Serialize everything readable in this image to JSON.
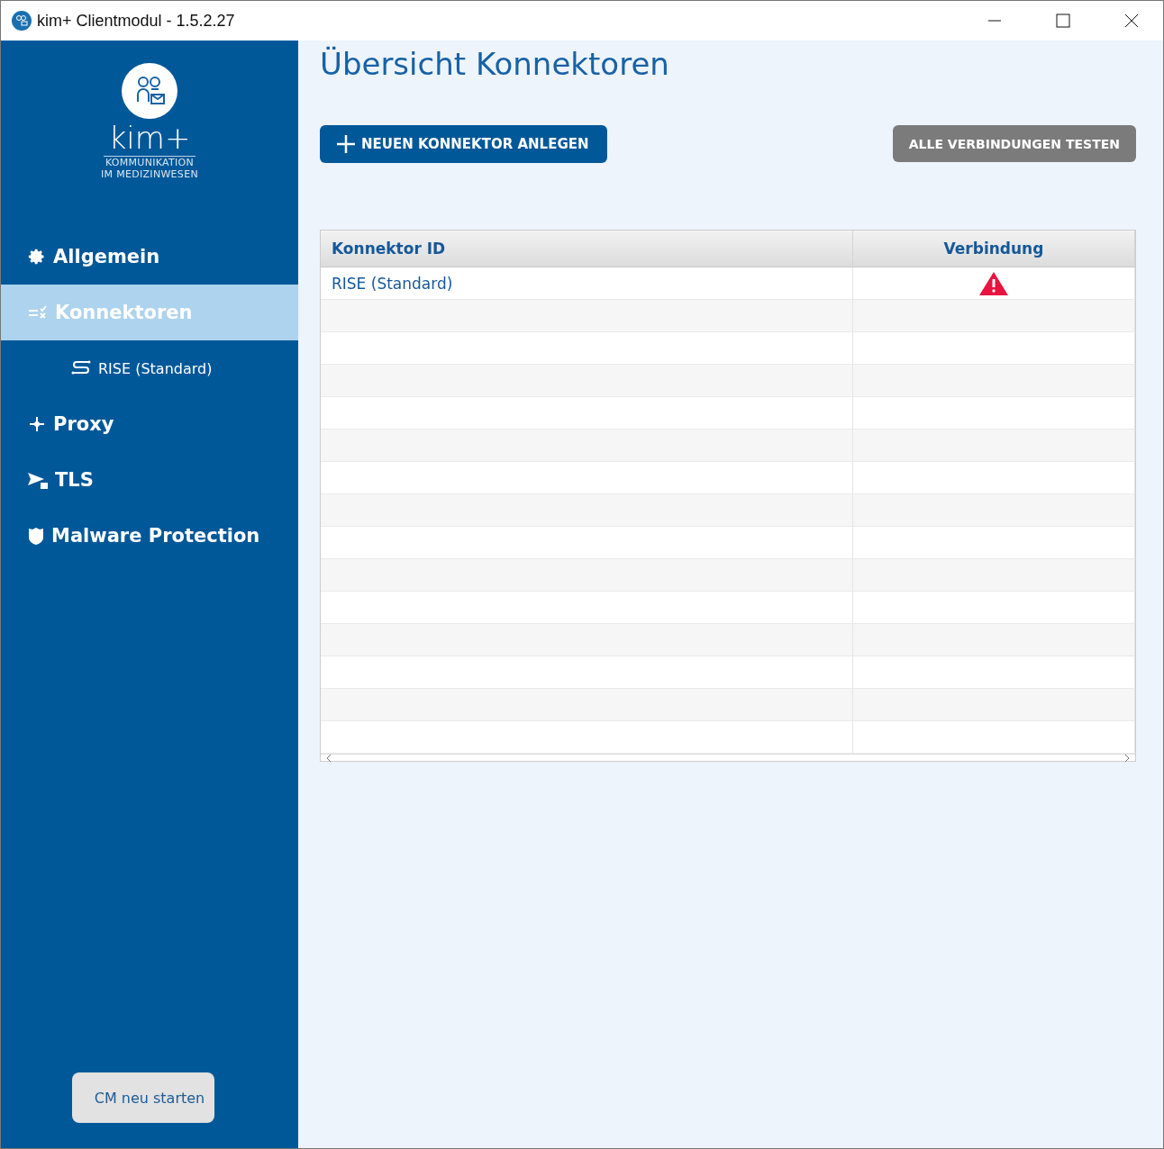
{
  "window": {
    "title": "kim+ Clientmodul - 1.5.2.27"
  },
  "logo": {
    "wordmark": "kim+",
    "tagline_1": "KOMMUNIKATION",
    "tagline_2": "IM MEDIZINWESEN"
  },
  "sidebar": {
    "items": [
      {
        "label": "Allgemein",
        "kind": "main",
        "selected": false
      },
      {
        "label": "Konnektoren",
        "kind": "main",
        "selected": true
      },
      {
        "label": "RISE (Standard)",
        "kind": "sub",
        "selected": false
      },
      {
        "label": "Proxy",
        "kind": "main",
        "selected": false
      },
      {
        "label": "TLS",
        "kind": "main",
        "selected": false
      },
      {
        "label": "Malware Protection",
        "kind": "main",
        "selected": false
      }
    ],
    "restart_button": "CM neu starten"
  },
  "main": {
    "title": "Übersicht Konnektoren",
    "add_button": "NEUEN KONNEKTOR ANLEGEN",
    "test_button": "ALLE VERBINDUNGEN TESTEN",
    "table": {
      "columns": [
        "Konnektor ID",
        "Verbindung"
      ],
      "rows": [
        {
          "id": "RISE (Standard)",
          "warning": true
        }
      ]
    }
  }
}
